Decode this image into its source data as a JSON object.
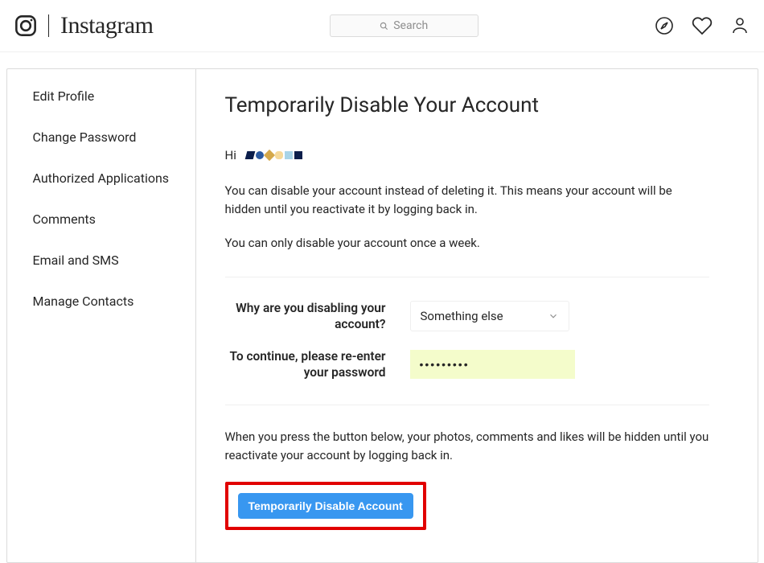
{
  "header": {
    "wordmark": "Instagram",
    "search_placeholder": "Search"
  },
  "sidebar": {
    "items": [
      {
        "label": "Edit Profile"
      },
      {
        "label": "Change Password"
      },
      {
        "label": "Authorized Applications"
      },
      {
        "label": "Comments"
      },
      {
        "label": "Email and SMS"
      },
      {
        "label": "Manage Contacts"
      }
    ]
  },
  "content": {
    "title": "Temporarily Disable Your Account",
    "greeting": "Hi",
    "desc1": "You can disable your account instead of deleting it. This means your account will be hidden until you reactivate it by logging back in.",
    "desc2": "You can only disable your account once a week.",
    "reason_label": "Why are you disabling your account?",
    "reason_selected": "Something else",
    "password_label": "To continue, please re-enter your password",
    "password_value": "•••••••••",
    "warn": "When you press the button below, your photos, comments and likes will be hidden until you reactivate your account by logging back in.",
    "button": "Temporarily Disable Account"
  }
}
